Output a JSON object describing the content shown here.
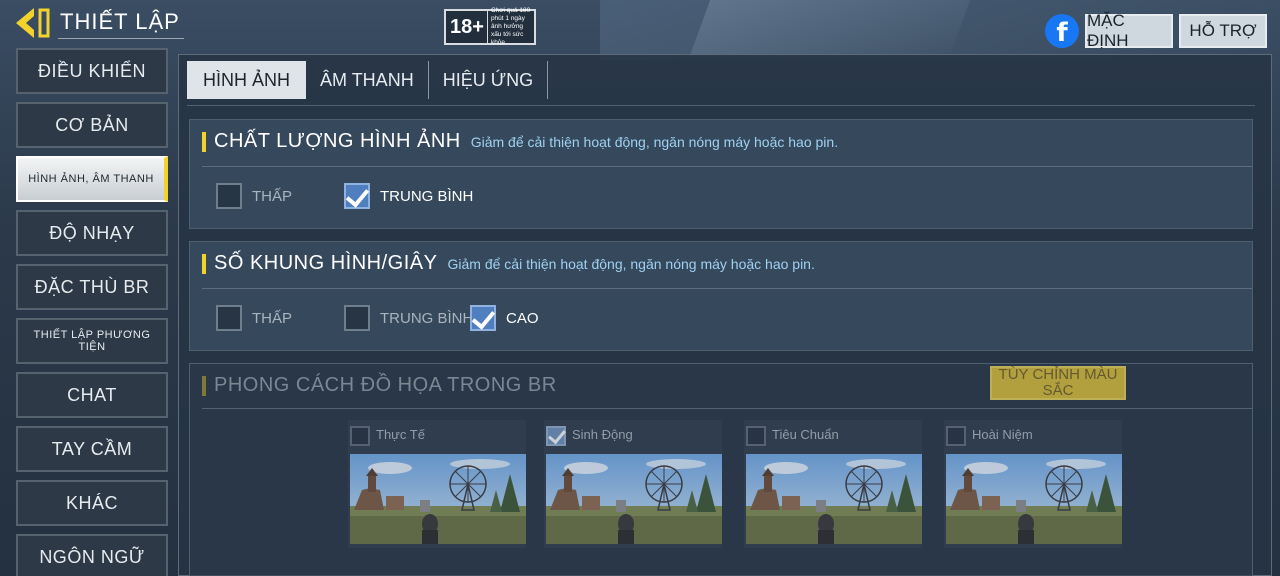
{
  "header": {
    "title": "THIẾT LẬP",
    "age_badge": {
      "rating": "18+",
      "text": "Chơi quá 180 phút 1 ngày ảnh hưởng xấu tới sức khỏe."
    },
    "default_label": "MẶC ĐỊNH",
    "support_label": "HỖ TRỢ"
  },
  "sidebar": {
    "items": [
      {
        "label": "ĐIỀU KHIỂN"
      },
      {
        "label": "CƠ BẢN"
      },
      {
        "label": "HÌNH ẢNH, ÂM THANH"
      },
      {
        "label": "ĐỘ NHẠY"
      },
      {
        "label": "ĐẶC THÙ BR"
      },
      {
        "label": "THIẾT LẬP PHƯƠNG TIỆN"
      },
      {
        "label": "CHAT"
      },
      {
        "label": "TAY CẦM"
      },
      {
        "label": "KHÁC"
      },
      {
        "label": "NGÔN NGỮ"
      }
    ]
  },
  "tabs": [
    {
      "label": "HÌNH ẢNH"
    },
    {
      "label": "ÂM THANH"
    },
    {
      "label": "HIỆU ỨNG"
    }
  ],
  "sections": {
    "quality": {
      "title": "CHẤT LƯỢNG HÌNH ẢNH",
      "desc": "Giảm để cải thiện hoạt động, ngăn nóng máy hoặc hao pin.",
      "options": [
        {
          "label": "THẤP",
          "checked": false
        },
        {
          "label": "TRUNG BÌNH",
          "checked": true
        }
      ]
    },
    "fps": {
      "title": "SỐ KHUNG HÌNH/GIÂY",
      "desc": "Giảm để cải thiện hoạt động, ngăn nóng máy hoặc hao pin.",
      "options": [
        {
          "label": "THẤP",
          "checked": false
        },
        {
          "label": "TRUNG BÌNH",
          "checked": false
        },
        {
          "label": "CAO",
          "checked": true
        }
      ]
    },
    "style": {
      "title": "PHONG CÁCH ĐỒ HỌA TRONG BR",
      "custom_color_label": "TÙY CHỈNH MÀU SẮC",
      "options": [
        {
          "label": "Thực Tế",
          "checked": false
        },
        {
          "label": "Sinh Động",
          "checked": true
        },
        {
          "label": "Tiêu Chuẩn",
          "checked": false
        },
        {
          "label": "Hoài Niệm",
          "checked": false
        }
      ]
    }
  },
  "colors": {
    "accent": "#f5d12b",
    "check": "#4f7fbf",
    "facebook": "#1877f2"
  }
}
